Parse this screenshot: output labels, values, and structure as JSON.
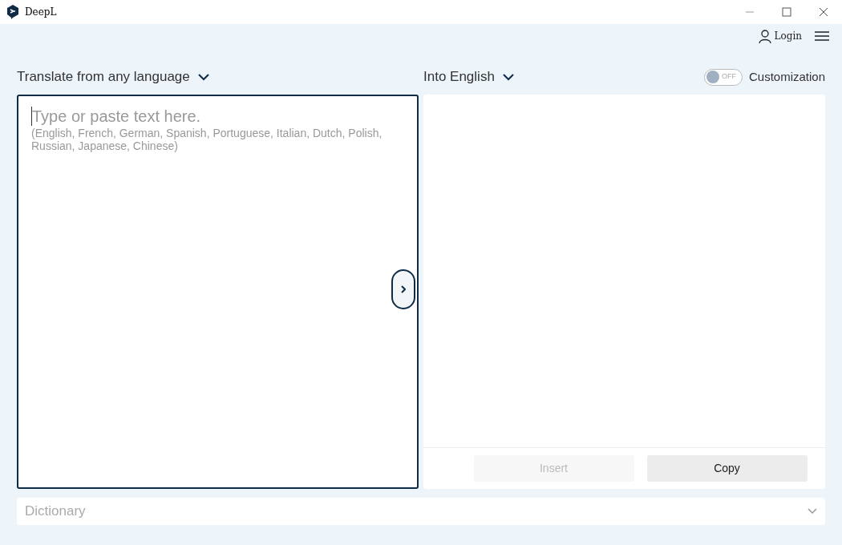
{
  "window": {
    "title": "DeepL"
  },
  "header": {
    "login": "Login"
  },
  "source": {
    "label": "Translate from",
    "language": "any language",
    "placeholder": "Type or paste text here.",
    "hint": "(English, French, German, Spanish, Portuguese, Italian, Dutch, Polish, Russian, Japanese, Chinese)"
  },
  "target": {
    "label": "Into English",
    "customization": {
      "on": false,
      "state_text": "OFF",
      "label": "Customization"
    }
  },
  "buttons": [
    {
      "label": "Insert",
      "disabled": true
    },
    {
      "label": "Copy",
      "disabled": false
    }
  ],
  "dictionary": {
    "label": "Dictionary",
    "expanded": false
  }
}
